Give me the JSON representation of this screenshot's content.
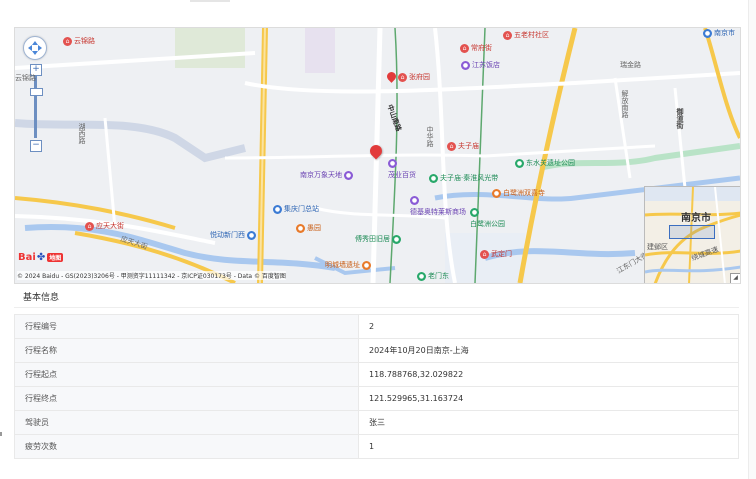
{
  "map": {
    "roads": [
      "云锦路",
      "瑞金路",
      "解放南路",
      "御道街",
      "湖西路",
      "中山南路",
      "中华路",
      "应天大街",
      "江东门大街"
    ],
    "pois": [
      {
        "name": "云锦路",
        "kind": "red"
      },
      {
        "name": "五老村社区",
        "kind": "red"
      },
      {
        "name": "常府街",
        "kind": "red"
      },
      {
        "name": "江苏饭店",
        "kind": "purple"
      },
      {
        "name": "张府园",
        "kind": "red"
      },
      {
        "name": "夫子庙",
        "kind": "red"
      },
      {
        "name": "南京万象天地",
        "kind": "purple"
      },
      {
        "name": "茂业百货",
        "kind": "purple"
      },
      {
        "name": "夫子庙·秦淮风光带",
        "kind": "green"
      },
      {
        "name": "东水关遗址公园",
        "kind": "green"
      },
      {
        "name": "白鹭洲双喜寺",
        "kind": "orange"
      },
      {
        "name": "集庆门总站",
        "kind": "blue"
      },
      {
        "name": "愚园",
        "kind": "orange"
      },
      {
        "name": "德基奥特莱斯商场",
        "kind": "purple"
      },
      {
        "name": "白鹭洲公园",
        "kind": "green"
      },
      {
        "name": "应天大街",
        "kind": "red"
      },
      {
        "name": "悦动新门西",
        "kind": "blue"
      },
      {
        "name": "傅秀田旧居",
        "kind": "green"
      },
      {
        "name": "明城墙遗址",
        "kind": "orange"
      },
      {
        "name": "武定门",
        "kind": "red"
      },
      {
        "name": "老门东",
        "kind": "green"
      },
      {
        "name": "南京市",
        "kind": "blue"
      }
    ],
    "overview": {
      "city": "南京市",
      "district1": "建邺区",
      "district2": "绕城高速",
      "toggle": "◢"
    },
    "logo": {
      "brand_left": "Bai",
      "brand_right": "地图"
    },
    "copyright": "© 2024 Baidu - GS(2023)3206号 - 甲测资字11111342 - 京ICP证030173号 - Data © 百度智图",
    "controls": {
      "zoom_in": "+",
      "zoom_out": "−"
    }
  },
  "section": {
    "title": "基本信息"
  },
  "table": {
    "rows": [
      {
        "label": "行程编号",
        "value": "2"
      },
      {
        "label": "行程名称",
        "value": "2024年10月20日南京-上海"
      },
      {
        "label": "行程起点",
        "value": "118.788768,32.029822"
      },
      {
        "label": "行程终点",
        "value": "121.529965,31.163724"
      },
      {
        "label": "驾驶员",
        "value": "张三"
      },
      {
        "label": "疲劳次数",
        "value": "1"
      }
    ]
  }
}
